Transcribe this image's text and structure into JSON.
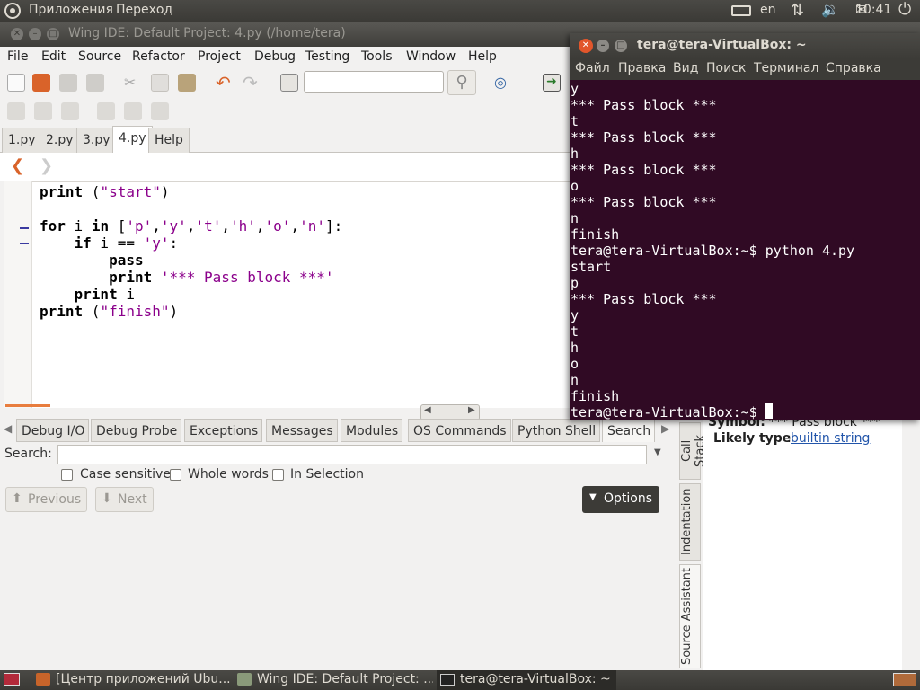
{
  "top_panel": {
    "apps": "Приложения",
    "places": "Переход",
    "kbd": "en",
    "time": "10:41"
  },
  "wing": {
    "title": "Wing IDE: Default Project: 4.py (/home/tera)",
    "menu": [
      "File",
      "Edit",
      "Source",
      "Refactor",
      "Project",
      "Debug",
      "Testing",
      "Tools",
      "Window",
      "Help"
    ],
    "file_tabs": [
      "1.py",
      "2.py",
      "3.py",
      "4.py",
      "Help"
    ],
    "active_tab": "4.py",
    "search_placeholder": ""
  },
  "code_lines": [
    "print (\"start\")",
    "",
    "for i in ['p','y','t','h','o','n']:",
    "    if i == 'y':",
    "        pass",
    "        print '*** Pass block ***'",
    "    print i",
    "print (\"finish\")"
  ],
  "bottom": {
    "tabs": [
      "Debug I/O",
      "Debug Probe",
      "Exceptions",
      "Messages",
      "Modules",
      "OS Commands",
      "Python Shell",
      "Search"
    ],
    "active_tab": "Search",
    "search_label": "Search:",
    "search_value": "",
    "case_sensitive": "Case sensitive",
    "whole_words": "Whole words",
    "in_selection": "In Selection",
    "previous": "Previous",
    "next": "Next",
    "options": "Options"
  },
  "side_tabs": [
    "Call Stack",
    "Indentation",
    "Source Assistant"
  ],
  "source_assistant": {
    "symbol_label": "Symbol:",
    "symbol_value": "'*** Pass block ***'",
    "type_label": "Likely type",
    "type_value": "builtin string"
  },
  "terminal": {
    "title": "tera@tera-VirtualBox: ~",
    "menu": [
      "Файл",
      "Правка",
      "Вид",
      "Поиск",
      "Терминал",
      "Справка"
    ],
    "lines": [
      "y",
      "*** Pass block ***",
      "t",
      "*** Pass block ***",
      "h",
      "*** Pass block ***",
      "o",
      "*** Pass block ***",
      "n",
      "finish",
      "tera@tera-VirtualBox:~$ python 4.py",
      "start",
      "p",
      "*** Pass block ***",
      "y",
      "t",
      "h",
      "o",
      "n",
      "finish",
      "tera@tera-VirtualBox:~$ "
    ]
  },
  "taskbar": {
    "items": [
      "[Центр приложений Ubu...",
      "Wing IDE: Default Project: ...",
      "tera@tera-VirtualBox: ~"
    ]
  },
  "colors": {
    "terminal_bg": "#300a24",
    "string": "#8b008b",
    "options_bg": "#3c3b37",
    "close_btn": "#e2562b"
  }
}
